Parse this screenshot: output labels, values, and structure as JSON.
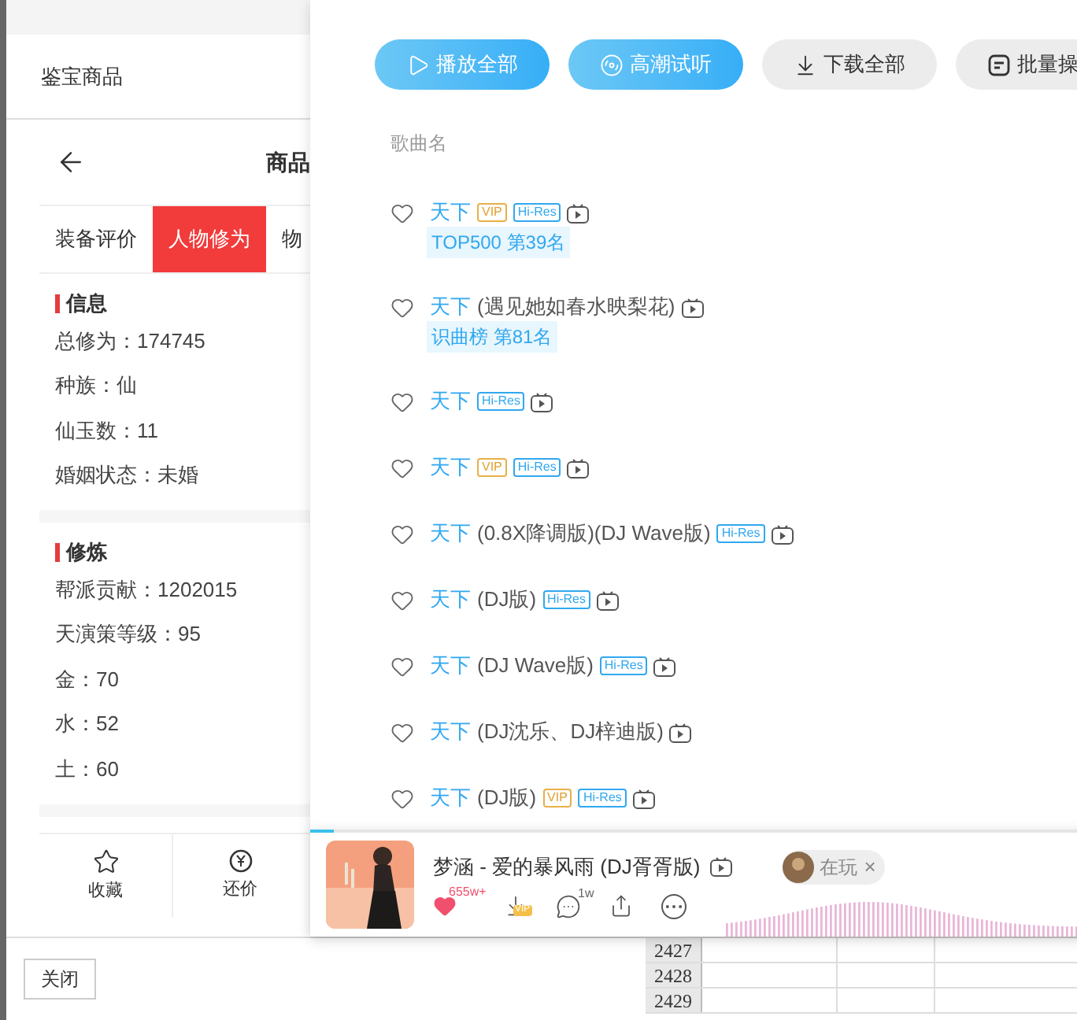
{
  "left_panel": {
    "header": "鉴宝商品",
    "title": "商品",
    "tabs": [
      {
        "label": "装备评价",
        "selected": false
      },
      {
        "label": "人物修为",
        "selected": true
      },
      {
        "label": "物",
        "selected": false
      }
    ],
    "sections": [
      {
        "heading": "信息",
        "fields": [
          "总修为：174745",
          "种族：仙",
          "仙玉数：11",
          "婚姻状态：未婚"
        ]
      },
      {
        "heading": "修炼",
        "fields": [
          "帮派贡献：1202015",
          "天演策等级：95",
          "金：70",
          "水：52",
          "土：60"
        ]
      }
    ],
    "actions": [
      {
        "kind": "star",
        "label": "收藏"
      },
      {
        "kind": "bid",
        "label": "还价"
      }
    ],
    "close_button": "关闭"
  },
  "music_panel": {
    "buttons": [
      {
        "kind": "play",
        "label": "播放全部",
        "primary": true
      },
      {
        "kind": "climax",
        "label": "高潮试听",
        "primary": true
      },
      {
        "kind": "download",
        "label": "下载全部",
        "primary": false
      },
      {
        "kind": "batch",
        "label": "批量操",
        "primary": false
      }
    ],
    "column_header": "歌曲名",
    "songs": [
      {
        "title": "天下",
        "badges": [
          {
            "kind": "vip",
            "label": "VIP"
          },
          {
            "kind": "hires",
            "label": "Hi-Res"
          }
        ],
        "rank": "TOP500 第39名"
      },
      {
        "title": "天下",
        "subtitle": "(遇见她如春水映梨花)",
        "rank": "识曲榜 第81名"
      },
      {
        "title": "天下",
        "badges": [
          {
            "kind": "hires",
            "label": "Hi-Res"
          }
        ]
      },
      {
        "title": "天下",
        "badges": [
          {
            "kind": "vip",
            "label": "VIP"
          },
          {
            "kind": "hires",
            "label": "Hi-Res"
          }
        ]
      },
      {
        "title": "天下",
        "subtitle": "(0.8X降调版)(DJ Wave版)",
        "badges": [
          {
            "kind": "hires",
            "label": "Hi-Res"
          }
        ]
      },
      {
        "title": "天下",
        "subtitle": "(DJ版)",
        "badges": [
          {
            "kind": "hires",
            "label": "Hi-Res"
          }
        ]
      },
      {
        "title": "天下",
        "subtitle": "(DJ Wave版)",
        "badges": [
          {
            "kind": "hires",
            "label": "Hi-Res"
          }
        ]
      },
      {
        "title": "天下",
        "subtitle": "(DJ沈乐、DJ梓迪版)"
      },
      {
        "title": "天下",
        "subtitle": "(DJ版)",
        "badges": [
          {
            "kind": "vip",
            "label": "VIP"
          },
          {
            "kind": "hires",
            "label": "Hi-Res"
          }
        ]
      }
    ],
    "player": {
      "level": 0.03,
      "title": "梦涵 - 爱的暴风雨 (DJ胥胥版)",
      "status": "在玩",
      "close": "×",
      "liked": true,
      "likes": "655w+",
      "vip_badge": "VIP",
      "comments": "1w"
    }
  },
  "spreadsheet": {
    "rows": [
      "2427",
      "2428",
      "2429"
    ]
  }
}
